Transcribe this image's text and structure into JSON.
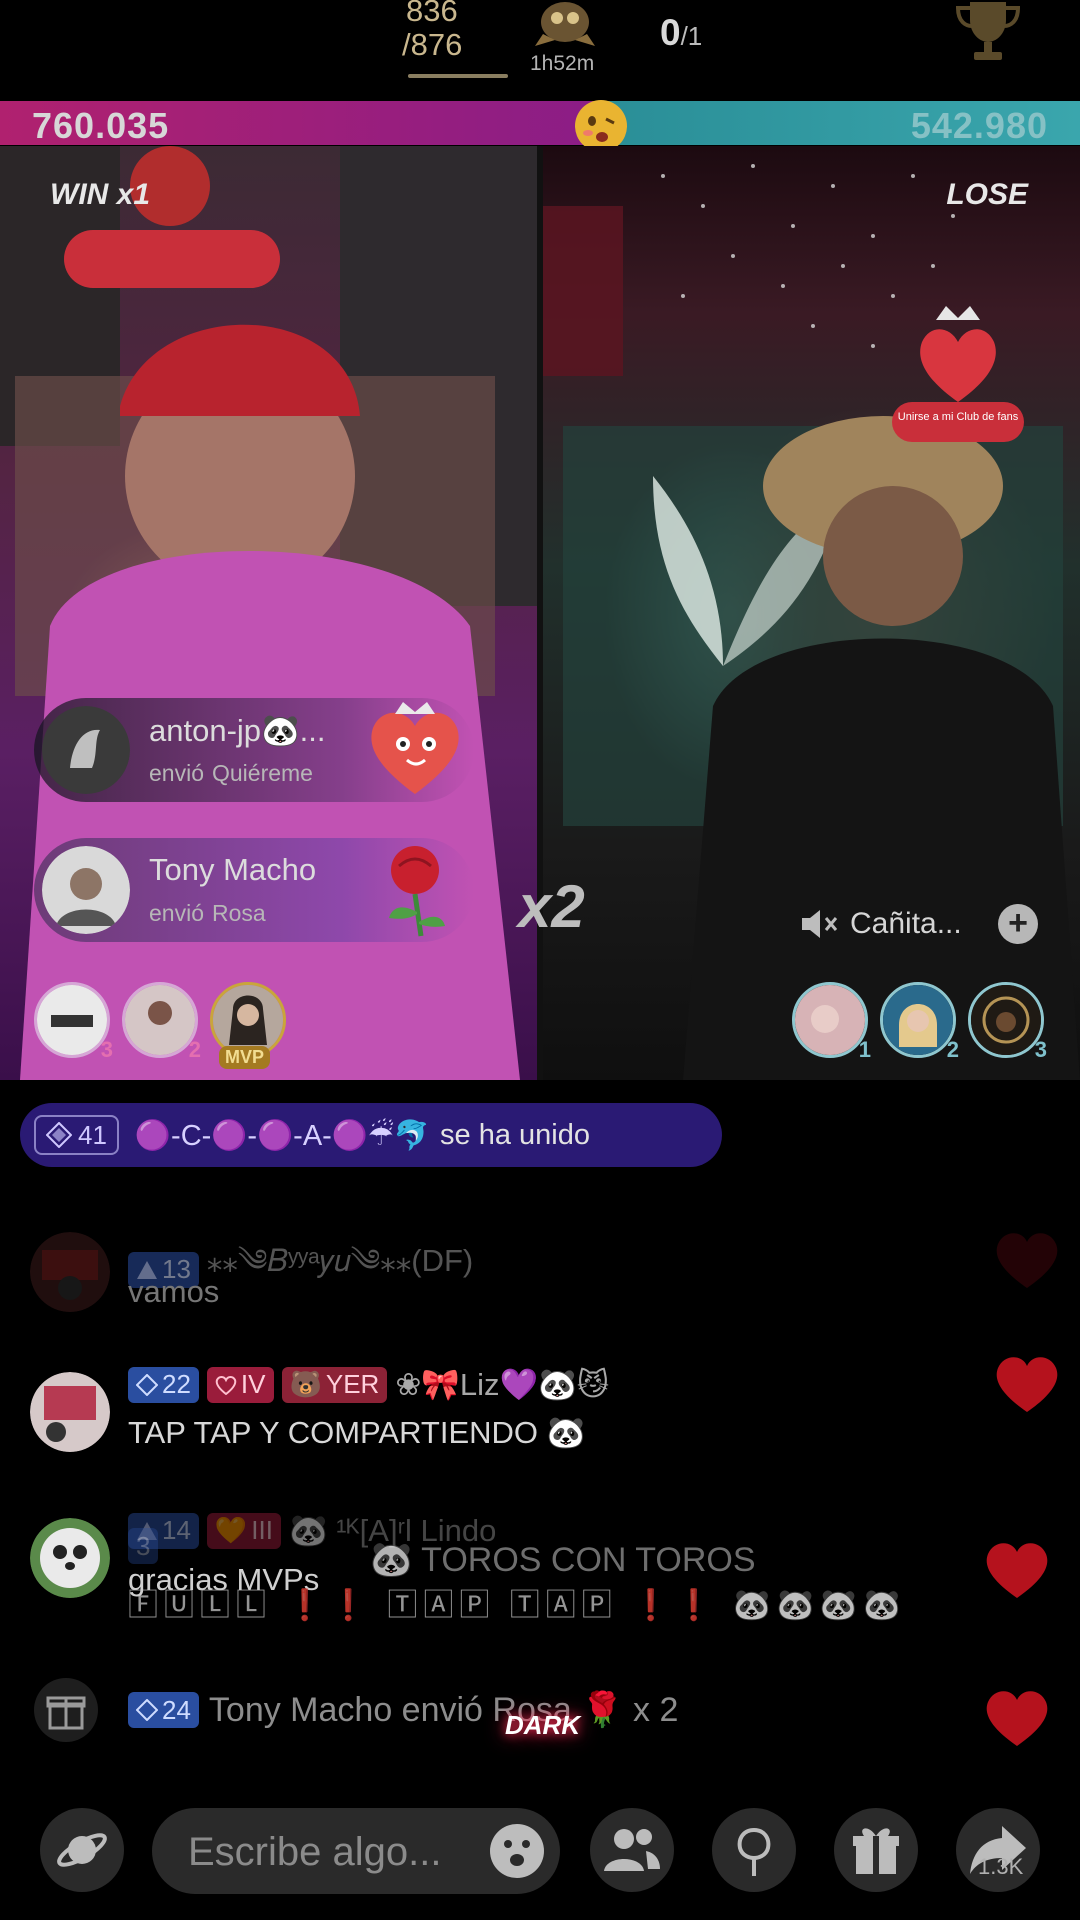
{
  "header": {
    "score_top": "836",
    "score_bottom": "/876",
    "timer": "1h52m",
    "round_value": "0",
    "round_total": "/1"
  },
  "battle": {
    "left_points": "760.035",
    "right_points": "542.980",
    "left_result": "WIN x1",
    "right_result": "LOSE",
    "combo": "x2",
    "fan_club_label": "Unirse a mi Club de fans",
    "colors": {
      "left_bar": "#b0216f",
      "right_bar": "#2a8e97"
    }
  },
  "gifts": [
    {
      "user": "anton-jp🐼...",
      "sent_label": "envió",
      "gift": "Quiéreme",
      "icon": "heart-mascot-icon"
    },
    {
      "user": "Tony Macho",
      "sent_label": "envió",
      "gift": "Rosa",
      "icon": "rose-icon"
    }
  ],
  "left_ranks": [
    {
      "rank": "3"
    },
    {
      "rank": "2"
    },
    {
      "rank": "MVP"
    }
  ],
  "right_ranks": [
    {
      "rank": "1"
    },
    {
      "rank": "2"
    },
    {
      "rank": "3"
    }
  ],
  "opponent": {
    "name": "Cañita...",
    "muted_icon": "speaker-muted-icon"
  },
  "chat": {
    "joined": {
      "level": "41",
      "name": "🟣-C-🟣-🟣-A-🟣☔🐬",
      "text": "se ha unido"
    },
    "messages": [
      {
        "level": "13",
        "name": "⁎⁎༄𝐵ʸʸᵃ𝑦𝑢༄⁎⁎(DF)",
        "text": "vamos"
      },
      {
        "level": "22",
        "fan_badge": "IV",
        "team_badge": "YER",
        "name": "❀🎀Liz💜🐼😼",
        "text": "TAP TAP Y COMPARTIENDO 🐼"
      },
      {
        "level": "14",
        "fan_badge": "III",
        "name": "🐼 ¹ᴷ[A]ʳl Lindo",
        "text": "gracias MVPs"
      }
    ],
    "overlap_name": "🐼 TOROS CON TOROS",
    "overlap_text": "🄵🅄🄻🄻 ❗❗ 🅃🄰🄿 🅃🄰🄿 ❗❗ 🐼🐼🐼🐼",
    "overlap_level": "3",
    "gift_message": {
      "level": "24",
      "text": "Tony Macho envió Rosa 🌹 x 2"
    },
    "watermark": "DARK"
  },
  "bottom": {
    "input_placeholder": "Escribe algo...",
    "share_count": "1.3K"
  }
}
